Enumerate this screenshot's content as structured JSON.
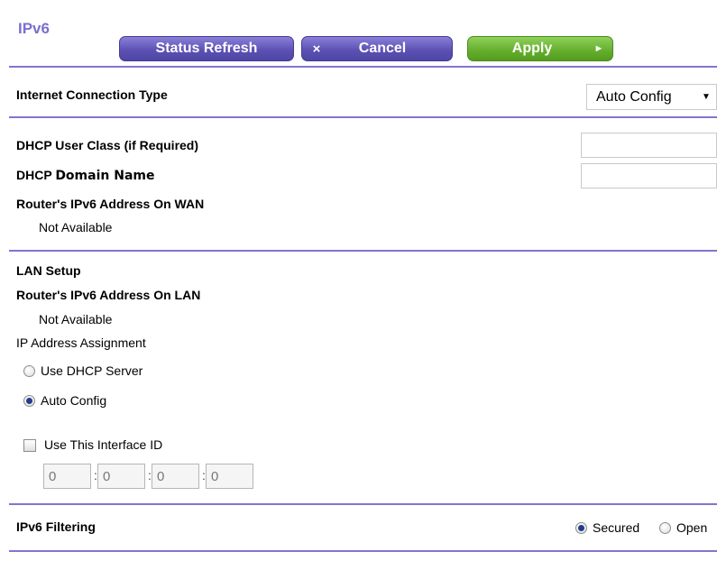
{
  "page": {
    "title": "IPv6"
  },
  "toolbar": {
    "refresh_label": "Status Refresh",
    "cancel_icon": "×",
    "cancel_label": "Cancel",
    "apply_label": "Apply",
    "apply_arrow": "►"
  },
  "connection": {
    "type_label": "Internet Connection Type",
    "type_value": "Auto Config",
    "caret": "▼"
  },
  "dhcp": {
    "user_class_label": "DHCP User Class (if Required)",
    "user_class_value": "",
    "domain_label_prefix": "DHCP ",
    "domain_label_bold": "Domain Name",
    "domain_value": "",
    "wan_address_label": "Router's IPv6 Address On WAN",
    "wan_address_value": "Not Available"
  },
  "lan": {
    "section_label": "LAN Setup",
    "lan_address_label": "Router's IPv6 Address On LAN",
    "lan_address_value": "Not Available",
    "assignment_label": "IP Address Assignment",
    "option_dhcp": "Use DHCP Server",
    "option_auto": "Auto Config",
    "selected_option": "Auto Config",
    "interface_id_label": "Use This Interface ID",
    "interface_id_checked": false,
    "interface_id_values": [
      "0",
      "0",
      "0",
      "0"
    ],
    "separator": ":"
  },
  "filtering": {
    "label": "IPv6 Filtering",
    "option_secured": "Secured",
    "option_open": "Open",
    "selected": "Secured"
  },
  "colors": {
    "accent": "#8076cf",
    "button_purple": "#5d52b4",
    "button_green": "#64ae2c",
    "title": "#7a6fd0"
  }
}
